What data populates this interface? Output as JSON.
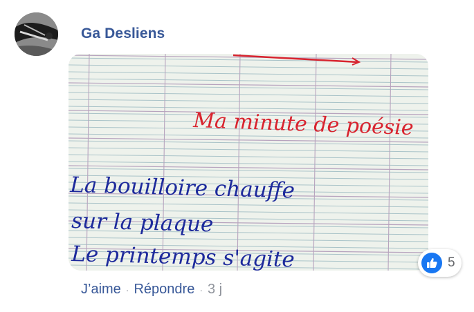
{
  "comment": {
    "author": "Ga Desliens",
    "image_handwriting": {
      "title": "Ma minute de poésie",
      "line1": "La bouilloire chauffe",
      "line2": "sur la plaque",
      "line3": "Le printemps s'agite"
    },
    "reaction_count": "5",
    "reaction_type": "like",
    "like_label": "J’aime",
    "reply_label": "Répondre",
    "separator": "·",
    "timestamp": "3 j"
  },
  "colors": {
    "link": "#385898",
    "muted": "#90949c",
    "like_blue": "#1877f2",
    "red_ink": "#d8242f",
    "blue_ink": "#1d2a9c"
  }
}
